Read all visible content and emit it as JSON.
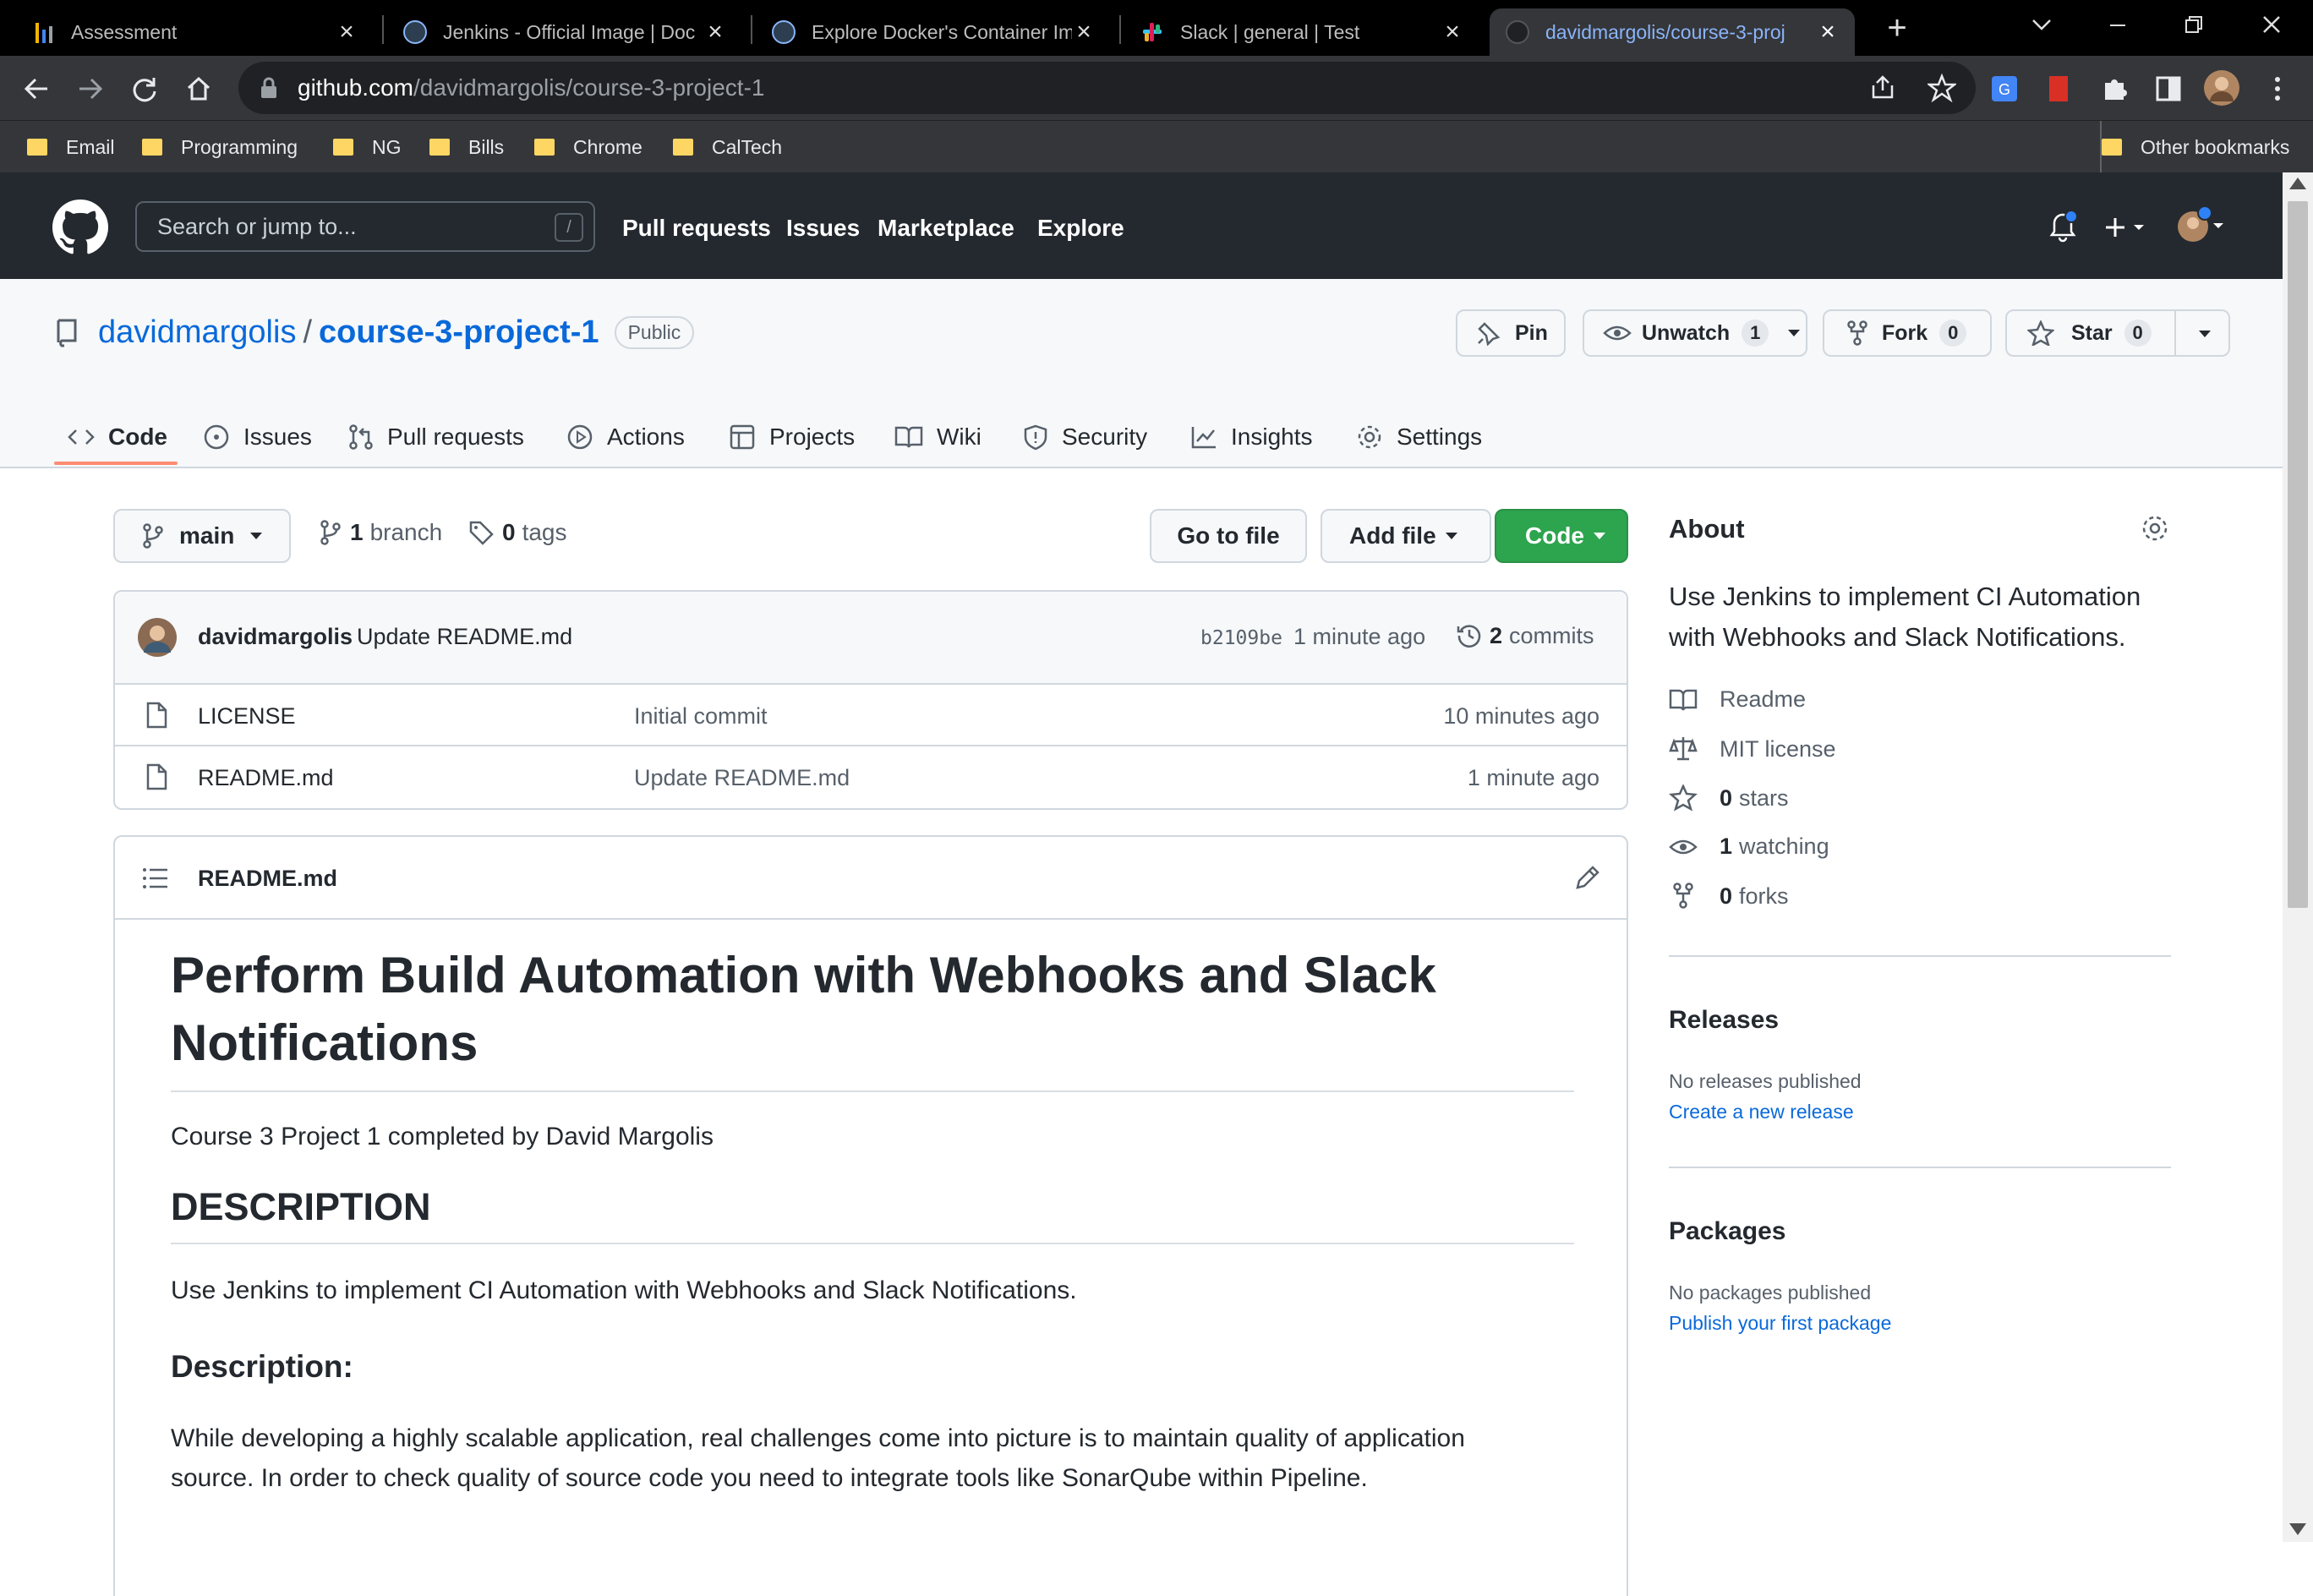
{
  "browser": {
    "tabs": [
      {
        "title": "Assessment",
        "active": false
      },
      {
        "title": "Jenkins - Official Image | Doc",
        "active": false
      },
      {
        "title": "Explore Docker's Container Im",
        "active": false
      },
      {
        "title": "Slack | general | Test",
        "active": false
      },
      {
        "title": "davidmargolis/course-3-proj",
        "active": true
      }
    ],
    "url_host": "github.com",
    "url_path": "/davidmargolis/course-3-project-1",
    "bookmarks": [
      "Email",
      "Programming",
      "NG",
      "Bills",
      "Chrome",
      "CalTech"
    ],
    "other_bookmarks": "Other bookmarks"
  },
  "github_nav": {
    "search_placeholder": "Search or jump to...",
    "search_key": "/",
    "links": [
      "Pull requests",
      "Issues",
      "Marketplace",
      "Explore"
    ]
  },
  "repo": {
    "owner": "davidmargolis",
    "separator": "/",
    "name": "course-3-project-1",
    "visibility": "Public",
    "pin_label": "Pin",
    "unwatch_label": "Unwatch",
    "watch_count": "1",
    "fork_label": "Fork",
    "fork_count": "0",
    "star_label": "Star",
    "star_count": "0",
    "tabs": [
      "Code",
      "Issues",
      "Pull requests",
      "Actions",
      "Projects",
      "Wiki",
      "Security",
      "Insights",
      "Settings"
    ],
    "active_tab": "Code"
  },
  "toolbar": {
    "branch": "main",
    "branch_count": "1",
    "branch_word": "branch",
    "tag_count": "0",
    "tag_word": "tags",
    "go_to_file": "Go to file",
    "add_file": "Add file",
    "code": "Code"
  },
  "latest_commit": {
    "author": "davidmargolis",
    "message": "Update README.md",
    "sha": "b2109be",
    "time": "1 minute ago",
    "commit_count": "2",
    "commit_word": "commits"
  },
  "files": [
    {
      "name": "LICENSE",
      "message": "Initial commit",
      "time": "10 minutes ago"
    },
    {
      "name": "README.md",
      "message": "Update README.md",
      "time": "1 minute ago"
    }
  ],
  "readme": {
    "filename": "README.md",
    "h1_line1": "Perform Build Automation with Webhooks and Slack",
    "h1_line2": "Notifications",
    "intro": "Course 3 Project 1 completed by David Margolis",
    "h2": "DESCRIPTION",
    "desc": "Use Jenkins to implement CI Automation with Webhooks and Slack Notifications.",
    "h3": "Description:",
    "para_line1": "While developing a highly scalable application, real challenges come into picture is to maintain quality of application",
    "para_line2": "source. In order to check quality of source code you need to integrate tools like SonarQube within Pipeline."
  },
  "about": {
    "title": "About",
    "desc_line1": "Use Jenkins to implement CI Automation",
    "desc_line2": "with Webhooks and Slack Notifications.",
    "readme": "Readme",
    "license": "MIT license",
    "stars_count": "0",
    "stars_word": "stars",
    "watching_count": "1",
    "watching_word": "watching",
    "forks_count": "0",
    "forks_word": "forks"
  },
  "releases": {
    "title": "Releases",
    "none": "No releases published",
    "link": "Create a new release"
  },
  "packages": {
    "title": "Packages",
    "none": "No packages published",
    "link": "Publish your first package"
  },
  "colors": {
    "accent_link": "#0969da",
    "code_button": "#2da44e",
    "active_tab_underline": "#fd8c73",
    "header_bg": "#24292f"
  }
}
